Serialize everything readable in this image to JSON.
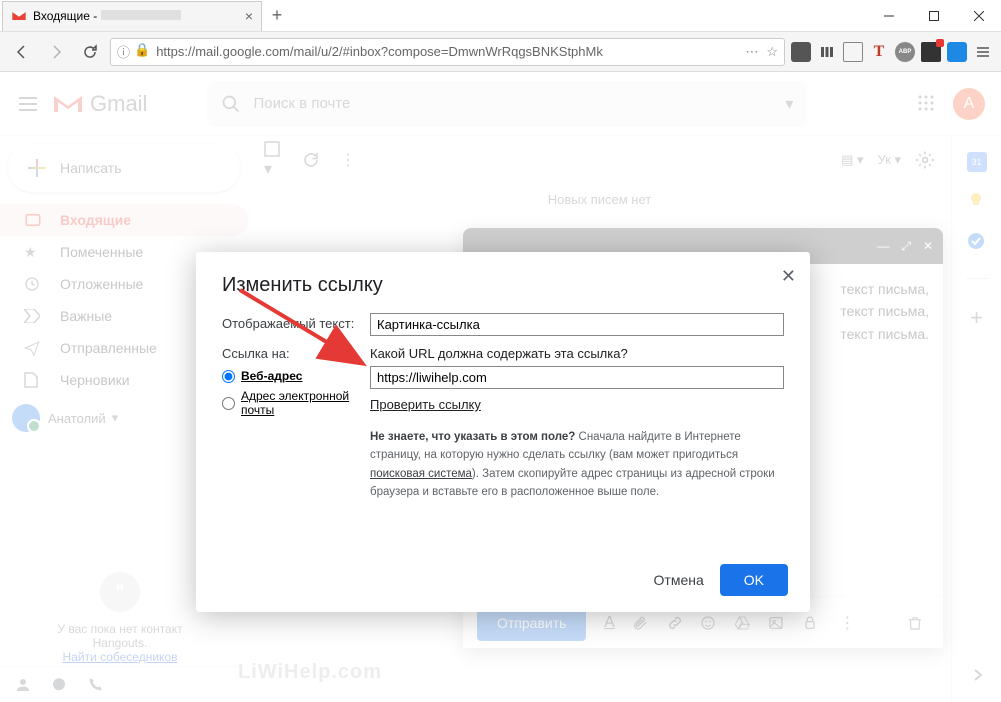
{
  "browser": {
    "tab_title": "Входящие -",
    "url": "https://mail.google.com/mail/u/2/#inbox?compose=DmwnWrRqgsBNKStphMk"
  },
  "gmail": {
    "brand": "Gmail",
    "search_placeholder": "Поиск в почте",
    "compose": "Написать",
    "avatar_letter": "A",
    "profile_name": "Анатолий",
    "nav": {
      "inbox": "Входящие",
      "starred": "Помеченные",
      "snoozed": "Отложенные",
      "important": "Важные",
      "sent": "Отправленные",
      "drafts": "Черновики"
    },
    "toolbar_lang": "Ук",
    "no_new_mail": "Новых писем нет",
    "hangouts_text1": "У вас пока нет контакт",
    "hangouts_text2": "Hangouts.",
    "hangouts_link": "Найти собеседников"
  },
  "compose_win": {
    "body1": "текст письма,",
    "body2": "текст письма,",
    "body3": "текст письма.",
    "send": "Отправить"
  },
  "modal": {
    "title": "Изменить ссылку",
    "display_text_label": "Отображаемый текст:",
    "display_text_value": "Картинка-ссылка",
    "link_to_label": "Ссылка на:",
    "radio_web": "Веб-адрес",
    "radio_email": "Адрес электронной почты",
    "url_question": "Какой URL должна содержать эта ссылка?",
    "url_value": "https://liwihelp.com",
    "check_link": "Проверить ссылку",
    "help_bold": "Не знаете, что указать в этом поле?",
    "help1": " Сначала найдите в Интернете страницу, на которую нужно сделать ссылку (вам может пригодиться ",
    "help_link": "поисковая система",
    "help2": "). Затем скопируйте адрес страницы из адресной строки браузера и вставьте его в расположенное выше поле.",
    "cancel": "Отмена",
    "ok": "OK"
  },
  "watermark": "LiWiHelp.com"
}
